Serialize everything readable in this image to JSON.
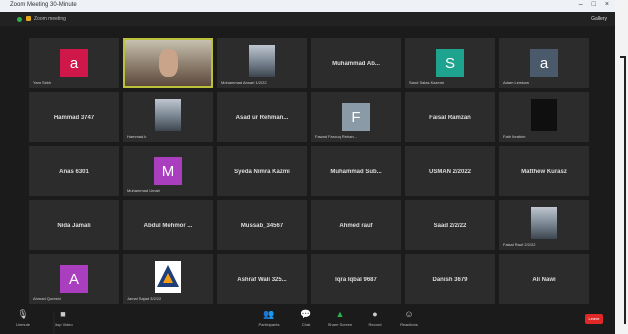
{
  "window": {
    "title": "Zoom Meeting 30-Minute"
  },
  "topbar": {
    "meeting_label": "Zoom meeting",
    "view_label": "Gallery"
  },
  "participants": [
    {
      "name": "",
      "sub": "Yam Sekh",
      "type": "avatar",
      "letter": "a",
      "color": "#d0174a"
    },
    {
      "name": "",
      "sub": "",
      "type": "photo",
      "active": true
    },
    {
      "name": "",
      "sub": "Mohammad Ansari 1/2/22",
      "type": "photo"
    },
    {
      "name": "Muhammad Ab...",
      "sub": "",
      "type": "name"
    },
    {
      "name": "",
      "sub": "Sand Salas Kazemi",
      "type": "avatar",
      "letter": "S",
      "color": "#1ea38f"
    },
    {
      "name": "",
      "sub": "Adam Lewkow",
      "type": "avatar",
      "letter": "a",
      "color": "#4a5a6a"
    },
    {
      "name": "Hammad 3747",
      "sub": "",
      "type": "name"
    },
    {
      "name": "",
      "sub": "Hammad.k",
      "type": "photo"
    },
    {
      "name": "Asad ur Rehman...",
      "sub": "",
      "type": "name"
    },
    {
      "name": "",
      "sub": "Fawad Farooq Rehan...",
      "type": "avatar",
      "letter": "F",
      "color": "#8a9aa6"
    },
    {
      "name": "Faisal Ramzan",
      "sub": "",
      "type": "name"
    },
    {
      "name": "",
      "sub": "Fatir Ibrahim",
      "type": "dark"
    },
    {
      "name": "Anas 6301",
      "sub": "",
      "type": "name"
    },
    {
      "name": "",
      "sub": "Muhammad Umair",
      "type": "avatar",
      "letter": "M",
      "color": "#a93fbf"
    },
    {
      "name": "Syeda Nimra Kazmi",
      "sub": "",
      "type": "name"
    },
    {
      "name": "Muhammad Sub...",
      "sub": "",
      "type": "name"
    },
    {
      "name": "USMAN 2/2022",
      "sub": "",
      "type": "name"
    },
    {
      "name": "Matthew Kurasz",
      "sub": "",
      "type": "name"
    },
    {
      "name": "Nida Jamali",
      "sub": "",
      "type": "name"
    },
    {
      "name": "Abdul Mehmor ...",
      "sub": "",
      "type": "name"
    },
    {
      "name": "Mussab_34567",
      "sub": "",
      "type": "name"
    },
    {
      "name": "Ahmed rauf",
      "sub": "",
      "type": "name"
    },
    {
      "name": "Saad 2/2/22",
      "sub": "",
      "type": "name"
    },
    {
      "name": "",
      "sub": "Faisal Rauf 2/2/22",
      "type": "photo"
    },
    {
      "name": "",
      "sub": "Ahmad Qureshi",
      "type": "avatar",
      "letter": "A",
      "color": "#a93fbf"
    },
    {
      "name": "",
      "sub": "Jamal Sajad 3/2/22",
      "type": "logo"
    },
    {
      "name": "Ashraf Wali 325...",
      "sub": "",
      "type": "name"
    },
    {
      "name": "Iqra Iqbal 9687",
      "sub": "",
      "type": "name"
    },
    {
      "name": "Danish 3679",
      "sub": "",
      "type": "name"
    },
    {
      "name": "Ali Nawi",
      "sub": "",
      "type": "name"
    }
  ],
  "toolbar": {
    "unmute": "Unmute",
    "stop_video": "Stop Video",
    "participants": "Participants",
    "chat": "Chat",
    "share": "Share Screen",
    "record": "Record",
    "reactions": "Reactions",
    "end": "Leave"
  }
}
